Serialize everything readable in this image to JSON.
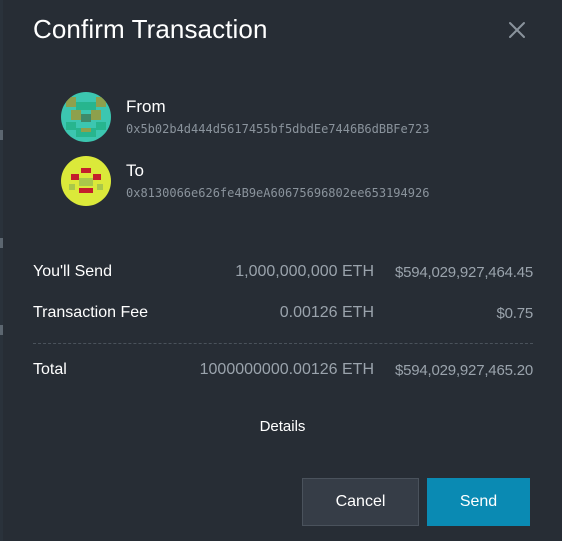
{
  "dialog": {
    "title": "Confirm Transaction",
    "close_icon": "close-icon"
  },
  "from": {
    "label": "From",
    "address": "0x5b02b4d444d5617455bf5dbdEe7446B6dBBFe723",
    "avatar_icon": "identicon-avatar",
    "avatar_colors": [
      "#3cc6b0",
      "#8ea04c",
      "#27b58e"
    ]
  },
  "to": {
    "label": "To",
    "address": "0x8130066e626fe4B9eA60675696802ee653194926",
    "avatar_icon": "identicon-avatar",
    "avatar_colors": [
      "#dbe93a",
      "#c41e2c",
      "#a9c84a"
    ]
  },
  "summary": {
    "send": {
      "label": "You'll Send",
      "eth": "1,000,000,000 ETH",
      "usd": "$594,029,927,464.45"
    },
    "fee": {
      "label": "Transaction Fee",
      "eth": "0.00126 ETH",
      "usd": "$0.75"
    },
    "total": {
      "label": "Total",
      "eth": "1000000000.00126 ETH",
      "usd": "$594,029,927,465.20"
    }
  },
  "details_label": "Details",
  "buttons": {
    "cancel": "Cancel",
    "send": "Send"
  },
  "colors": {
    "dialog_bg": "#272d35",
    "accent": "#0a8ab3",
    "muted_text": "#9aa3ac"
  }
}
